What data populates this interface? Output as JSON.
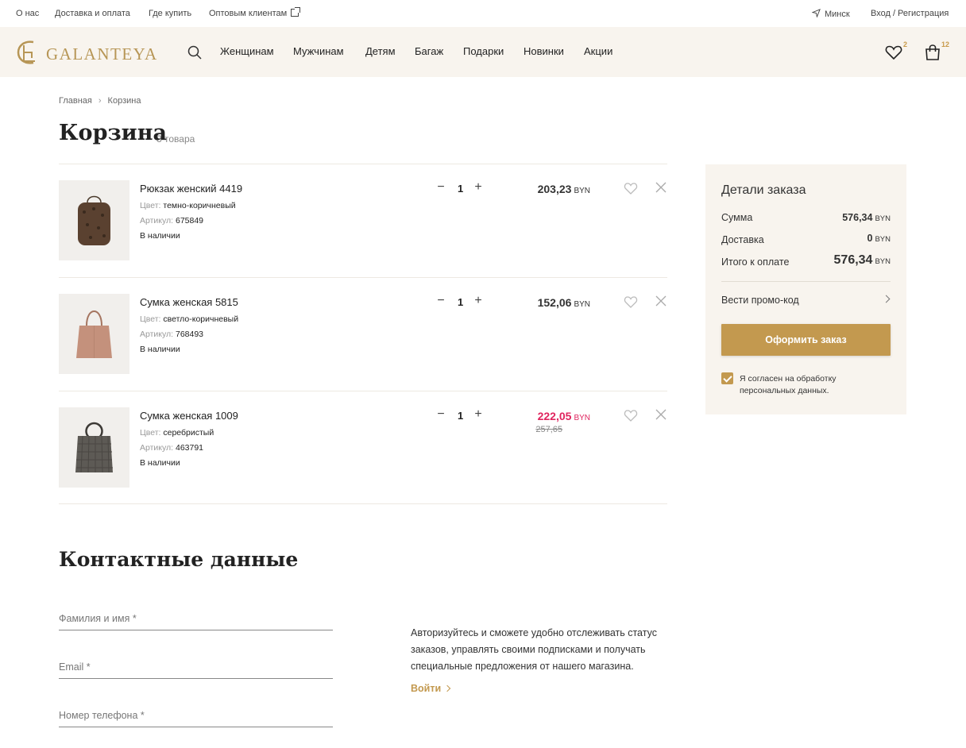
{
  "topbar": {
    "about": "О нас",
    "delivery": "Доставка и оплата",
    "where_buy": "Где купить",
    "wholesale": "Оптовым клиентам",
    "city": "Минск",
    "login_register": "Вход / Регистрация"
  },
  "header": {
    "logo": "GALANTEYA",
    "nav": [
      "Женщинам",
      "Мужчинам",
      "Детям",
      "Багаж",
      "Подарки",
      "Новинки",
      "Акции"
    ],
    "wishlist_count": "2",
    "cart_count": "12"
  },
  "breadcrumbs": [
    "Главная",
    "Корзина"
  ],
  "page": {
    "title": "Корзина",
    "count": "3 товара"
  },
  "labels": {
    "color": "Цвет:",
    "article": "Артикул:",
    "currency": "BYN"
  },
  "cart": {
    "items": [
      {
        "name": "Рюкзак женский 4419",
        "color": "темно-коричневый",
        "article": "675849",
        "stock": "В наличии",
        "qty": "1",
        "price": "203,23",
        "sale": false,
        "image": "backpack"
      },
      {
        "name": "Сумка женская 5815",
        "color": "светло-коричневый",
        "article": "768493",
        "stock": "В наличии",
        "qty": "1",
        "price": "152,06",
        "sale": false,
        "image": "tote-bag"
      },
      {
        "name": "Сумка женская 1009",
        "color": "серебристый",
        "article": "463791",
        "stock": "В наличии",
        "qty": "1",
        "price": "222,05",
        "old_price": "257,65",
        "sale": true,
        "image": "ring-handle-bag"
      }
    ]
  },
  "order": {
    "title": "Детали заказа",
    "sum_label": "Сумма",
    "sum_value": "576,34",
    "delivery_label": "Доставка",
    "delivery_value": "0",
    "total_label": "Итого к оплате",
    "total_value": "576,34",
    "promo": "Вести промо-код",
    "checkout": "Оформить заказ",
    "agree": "Я согласен на обработку персональных данных."
  },
  "contacts": {
    "title": "Контактные данные",
    "name_placeholder": "Фамилия и имя *",
    "email_placeholder": "Email *",
    "phone_placeholder": "Номер телефона *",
    "info": "Авторизуйтесь и сможете удобно отслеживать статус заказов, управлять своими подписками и получать специальные предложения от нашего магазина.",
    "login": "Войти"
  },
  "colors": {
    "accent": "#c3994f",
    "header_bg": "#f8f4ee",
    "sale": "#e0245e"
  }
}
